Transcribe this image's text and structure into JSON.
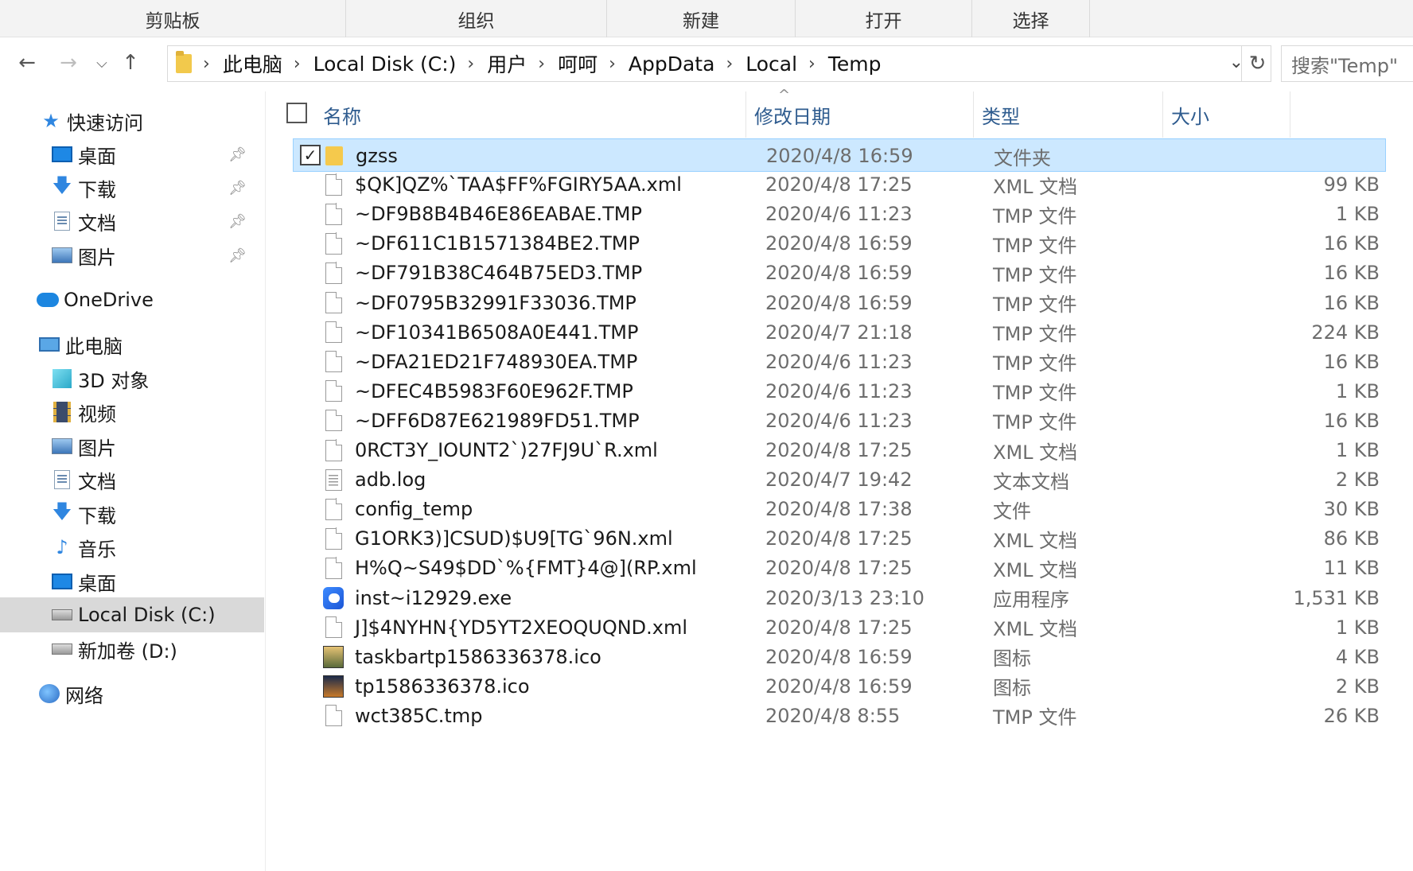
{
  "ribbon": {
    "groups": [
      "剪贴板",
      "组织",
      "新建",
      "打开",
      "选择"
    ]
  },
  "address": {
    "crumbs": [
      "此电脑",
      "Local Disk (C:)",
      "用户",
      "呵呵",
      "AppData",
      "Local",
      "Temp"
    ],
    "search_placeholder": "搜索\"Temp\""
  },
  "nav": {
    "quick_access": "快速访问",
    "quick_items": [
      "桌面",
      "下载",
      "文档",
      "图片"
    ],
    "onedrive": "OneDrive",
    "this_pc": "此电脑",
    "pc_items": [
      "3D 对象",
      "视频",
      "图片",
      "文档",
      "下载",
      "音乐",
      "桌面",
      "Local Disk (C:)",
      "新加卷 (D:)"
    ],
    "network": "网络"
  },
  "columns": {
    "name": "名称",
    "date": "修改日期",
    "type": "类型",
    "size": "大小"
  },
  "files": [
    {
      "name": "gzss",
      "date": "2020/4/8 16:59",
      "type": "文件夹",
      "size": "",
      "icon": "folder-icon"
    },
    {
      "name": "$QK]QZ%`TAA$FF%FGIRY5AA.xml",
      "date": "2020/4/8 17:25",
      "type": "XML 文档",
      "size": "99 KB",
      "icon": "file-icon"
    },
    {
      "name": "~DF9B8B4B46E86EABAE.TMP",
      "date": "2020/4/6 11:23",
      "type": "TMP 文件",
      "size": "1 KB",
      "icon": "file-icon"
    },
    {
      "name": "~DF611C1B1571384BE2.TMP",
      "date": "2020/4/8 16:59",
      "type": "TMP 文件",
      "size": "16 KB",
      "icon": "file-icon"
    },
    {
      "name": "~DF791B38C464B75ED3.TMP",
      "date": "2020/4/8 16:59",
      "type": "TMP 文件",
      "size": "16 KB",
      "icon": "file-icon"
    },
    {
      "name": "~DF0795B32991F33036.TMP",
      "date": "2020/4/8 16:59",
      "type": "TMP 文件",
      "size": "16 KB",
      "icon": "file-icon"
    },
    {
      "name": "~DF10341B6508A0E441.TMP",
      "date": "2020/4/7 21:18",
      "type": "TMP 文件",
      "size": "224 KB",
      "icon": "file-icon"
    },
    {
      "name": "~DFA21ED21F748930EA.TMP",
      "date": "2020/4/6 11:23",
      "type": "TMP 文件",
      "size": "16 KB",
      "icon": "file-icon"
    },
    {
      "name": "~DFEC4B5983F60E962F.TMP",
      "date": "2020/4/6 11:23",
      "type": "TMP 文件",
      "size": "1 KB",
      "icon": "file-icon"
    },
    {
      "name": "~DFF6D87E621989FD51.TMP",
      "date": "2020/4/6 11:23",
      "type": "TMP 文件",
      "size": "16 KB",
      "icon": "file-icon"
    },
    {
      "name": "0RCT3Y_IOUNT2`)27FJ9U`R.xml",
      "date": "2020/4/8 17:25",
      "type": "XML 文档",
      "size": "1 KB",
      "icon": "file-icon"
    },
    {
      "name": "adb.log",
      "date": "2020/4/7 19:42",
      "type": "文本文档",
      "size": "2 KB",
      "icon": "text-file-icon"
    },
    {
      "name": "config_temp",
      "date": "2020/4/8 17:38",
      "type": "文件",
      "size": "30 KB",
      "icon": "file-icon"
    },
    {
      "name": "G1ORK3)]CSUD)$U9[TG`96N.xml",
      "date": "2020/4/8 17:25",
      "type": "XML 文档",
      "size": "86 KB",
      "icon": "file-icon"
    },
    {
      "name": "H%Q~S49$DD`%{FMT}4@](RP.xml",
      "date": "2020/4/8 17:25",
      "type": "XML 文档",
      "size": "11 KB",
      "icon": "file-icon"
    },
    {
      "name": "inst~i12929.exe",
      "date": "2020/3/13 23:10",
      "type": "应用程序",
      "size": "1,531 KB",
      "icon": "app-icon"
    },
    {
      "name": "J]$4NYHN{YD5YT2XEOQUQND.xml",
      "date": "2020/4/8 17:25",
      "type": "XML 文档",
      "size": "1 KB",
      "icon": "file-icon"
    },
    {
      "name": "taskbartp1586336378.ico",
      "date": "2020/4/8 16:59",
      "type": "图标",
      "size": "4 KB",
      "icon": "image-icon"
    },
    {
      "name": "tp1586336378.ico",
      "date": "2020/4/8 16:59",
      "type": "图标",
      "size": "2 KB",
      "icon": "image-icon"
    },
    {
      "name": "wct385C.tmp",
      "date": "2020/4/8 8:55",
      "type": "TMP 文件",
      "size": "26 KB",
      "icon": "file-icon"
    }
  ],
  "selected_row": 0
}
